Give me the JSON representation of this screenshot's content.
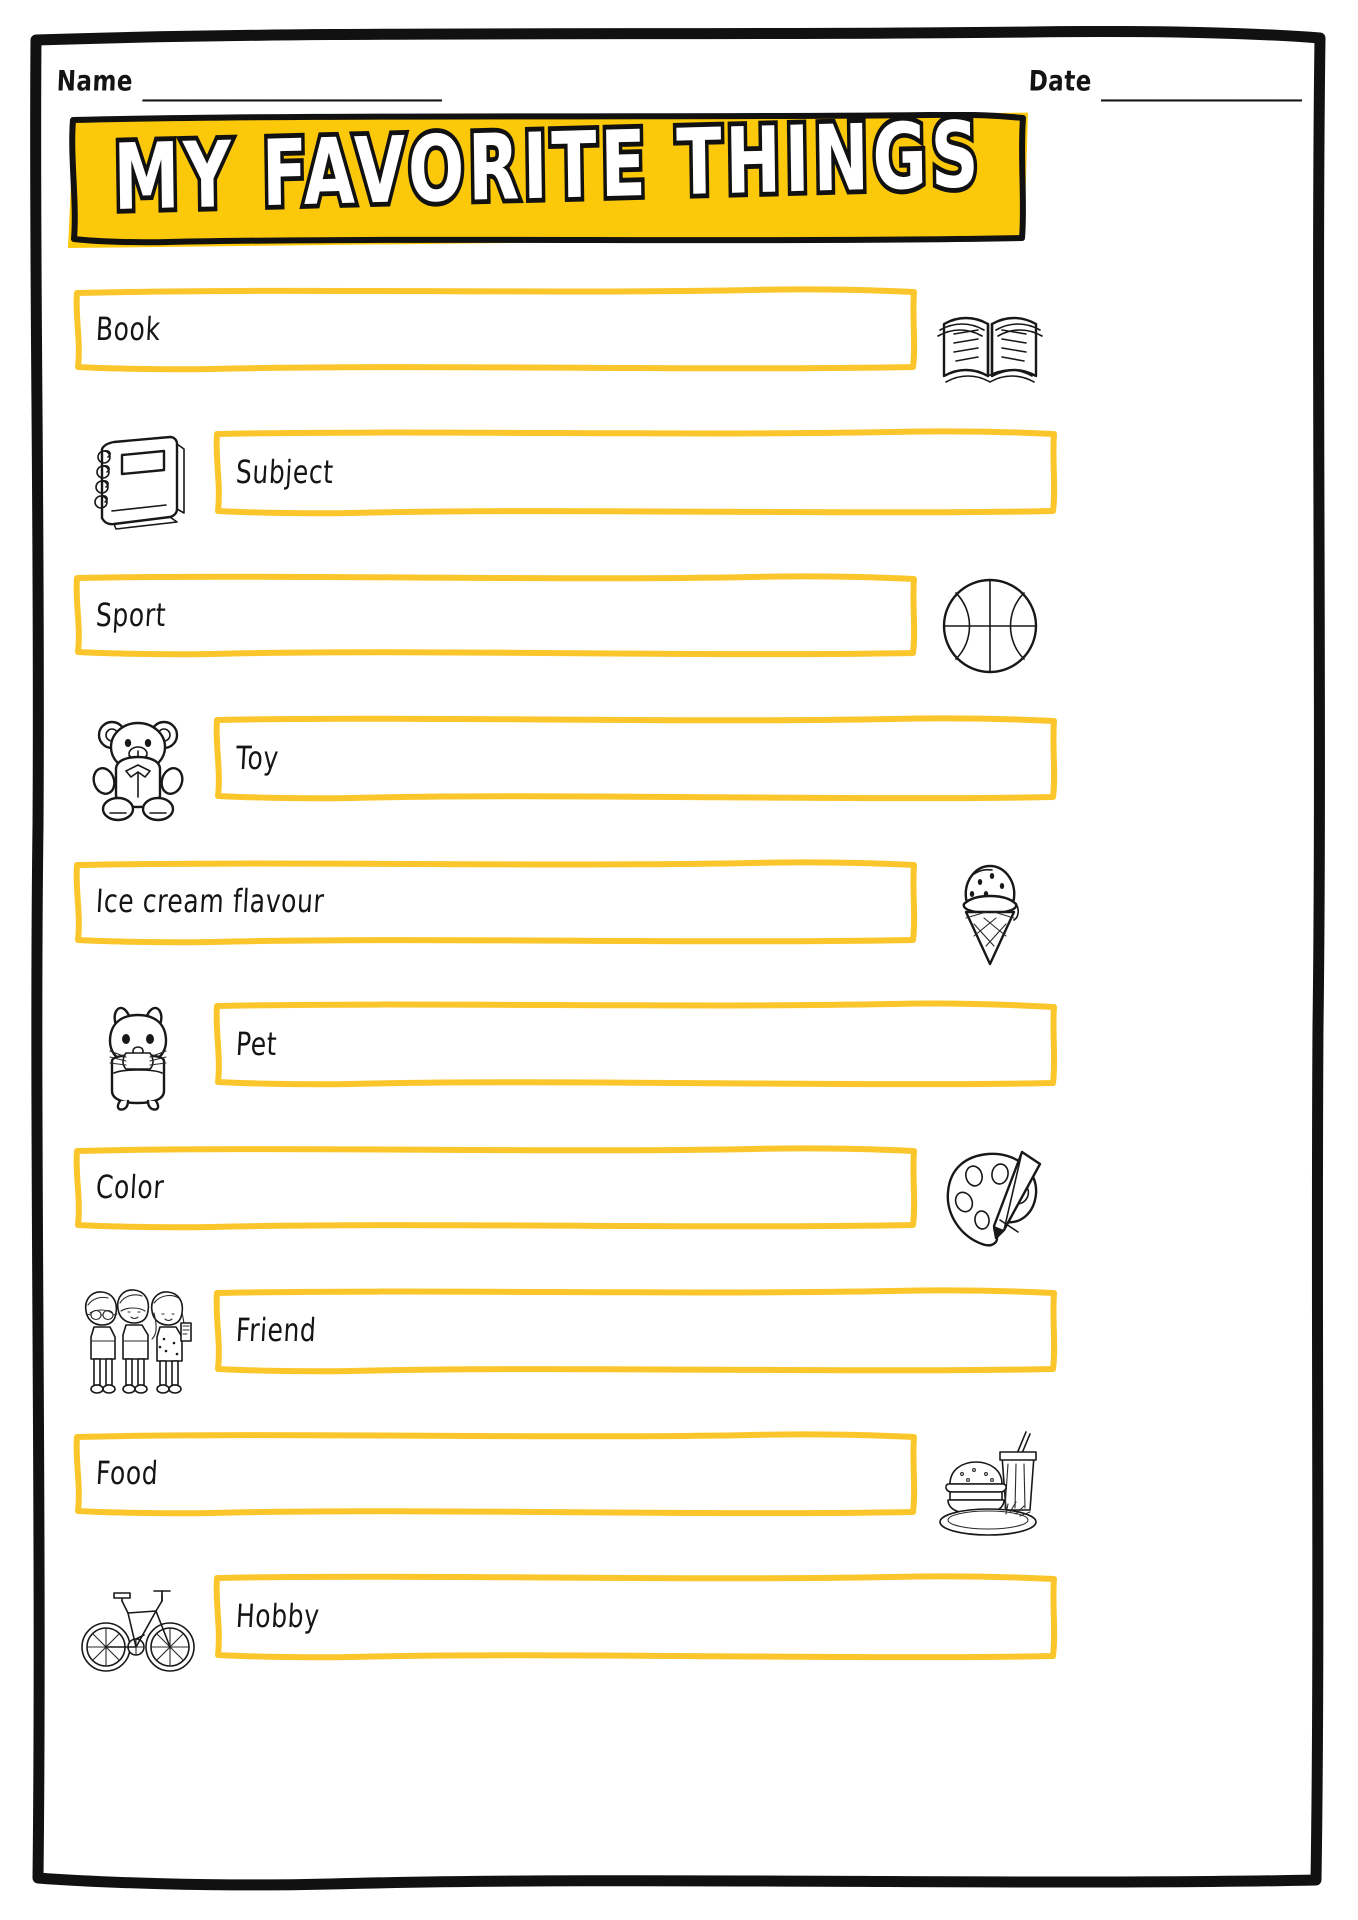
{
  "worksheet": {
    "title": "MY FAVORITE THINGS",
    "banner_color": "#FCC80A",
    "box_border_color": "#FBC62C",
    "ink_color": "#181818"
  },
  "header": {
    "name_label": "Name",
    "name_rule": "______________________________",
    "date_label": "Date",
    "date_rule": "____________________"
  },
  "rows": [
    {
      "label": "Book",
      "icon": "open-book-icon",
      "icon_side": "right"
    },
    {
      "label": "Subject",
      "icon": "notebook-icon",
      "icon_side": "left"
    },
    {
      "label": "Sport",
      "icon": "basketball-icon",
      "icon_side": "right"
    },
    {
      "label": "Toy",
      "icon": "teddy-bear-icon",
      "icon_side": "left"
    },
    {
      "label": "Ice cream flavour",
      "icon": "ice-cream-icon",
      "icon_side": "right"
    },
    {
      "label": "Pet",
      "icon": "hamster-icon",
      "icon_side": "left"
    },
    {
      "label": "Color",
      "icon": "paint-palette-icon",
      "icon_side": "right"
    },
    {
      "label": "Friend",
      "icon": "friends-icon",
      "icon_side": "left"
    },
    {
      "label": "Food",
      "icon": "fast-food-icon",
      "icon_side": "right"
    },
    {
      "label": "Hobby",
      "icon": "bicycle-icon",
      "icon_side": "left"
    }
  ]
}
